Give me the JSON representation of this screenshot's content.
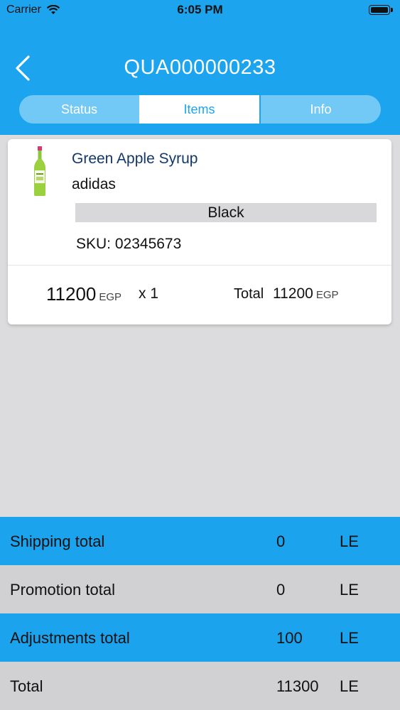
{
  "status_bar": {
    "carrier": "Carrier",
    "time": "6:05 PM"
  },
  "header": {
    "title": "QUA000000233",
    "back_icon": "chevron-left-icon"
  },
  "tabs": [
    {
      "label": "Status",
      "active": false
    },
    {
      "label": "Items",
      "active": true
    },
    {
      "label": "Info",
      "active": false
    }
  ],
  "item": {
    "name": "Green Apple Syrup",
    "brand": "adidas",
    "variant": "Black",
    "sku": "SKU: 02345673",
    "price": "11200",
    "currency": "EGP",
    "quantity": "x 1",
    "total_label": "Total",
    "total_value": "11200",
    "total_currency": "EGP"
  },
  "summary": [
    {
      "label": "Shipping total",
      "value": "0",
      "unit": "LE"
    },
    {
      "label": "Promotion total",
      "value": "0",
      "unit": "LE"
    },
    {
      "label": "Adjustments total",
      "value": "100",
      "unit": "LE"
    },
    {
      "label": "Total",
      "value": "11300",
      "unit": "LE"
    }
  ],
  "colors": {
    "header_blue": "#1da4ef",
    "tab_inactive": "#72c9f6",
    "row_blue": "#1ba3ee",
    "row_gray": "#d1d0d3",
    "product_name": "#12376b",
    "background": "#dcdbdd"
  }
}
